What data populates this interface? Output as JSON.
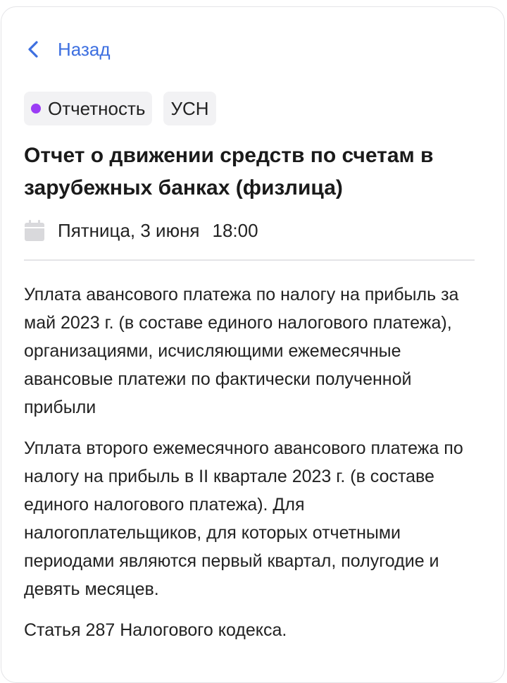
{
  "back": {
    "label": "Назад",
    "icon": "chevron-left-icon"
  },
  "tags": [
    {
      "label": "Отчетность",
      "dot_color": "#9b3cf5"
    },
    {
      "label": "УСН"
    }
  ],
  "event": {
    "title": "Отчет о движении средств по счетам в зарубежных банках (физлица)",
    "date": "Пятница, 3 июня",
    "time": "18:00",
    "date_icon": "calendar-icon"
  },
  "content": {
    "paragraphs": [
      "Уплата авансового платежа по налогу на прибыль за май 2023 г. (в составе единого налогового платежа), организациями, исчисляющими ежемесячные авансовые платежи по фактически полученной прибыли",
      "Уплата второго ежемесячного авансового платежа по налогу на прибыль в II квартале 2023 г. (в составе единого налогового платежа). Для налогоплательщиков, для которых отчетными периодами являются первый квартал, полугодие и девять месяцев.",
      "Статья 287 Налогового кодекса."
    ]
  },
  "colors": {
    "accent": "#3d6fe0",
    "tag_background": "#f2f2f4",
    "divider": "#e4e4e7",
    "icon_gray": "#d9d9dc"
  }
}
